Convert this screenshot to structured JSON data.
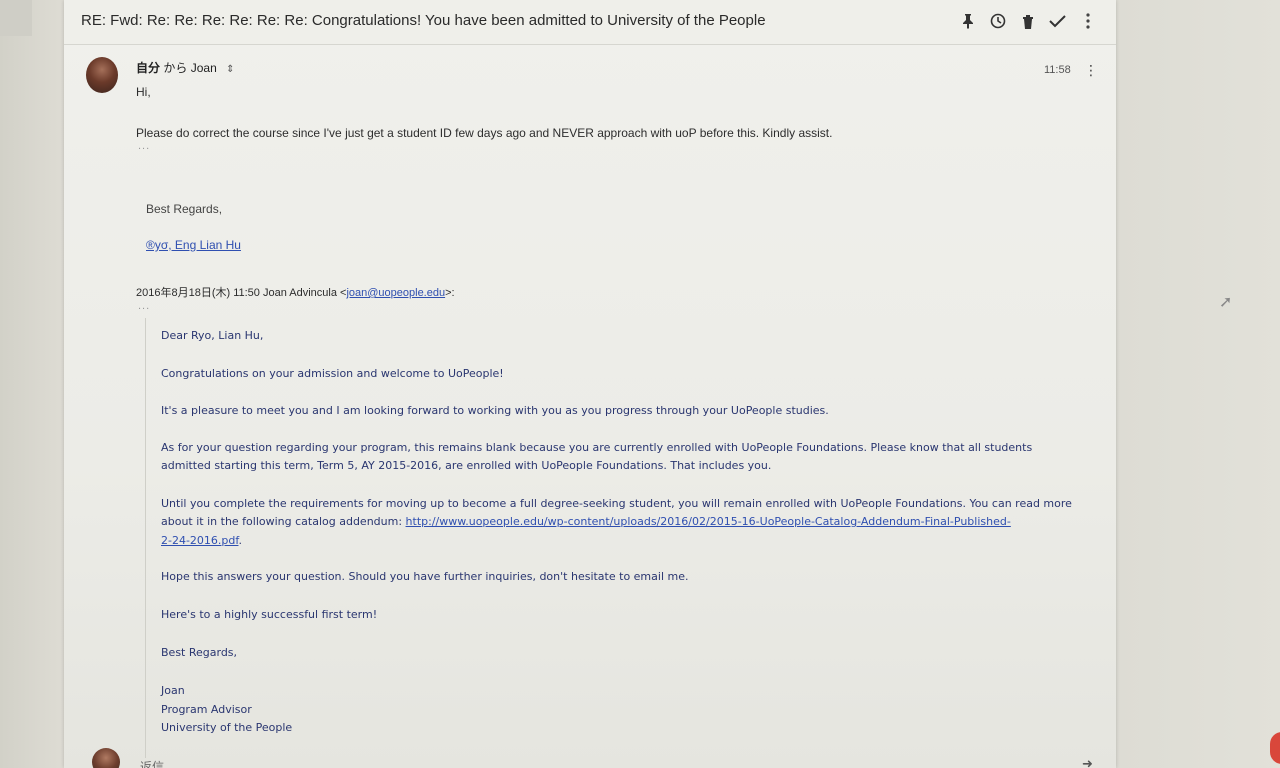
{
  "subject": "RE: Fwd: Re: Re: Re: Re: Re: Re: Congratulations! You have been admitted to University of the People",
  "toolbar": {
    "icons": [
      "pin-icon",
      "snooze-clock-icon",
      "trash-icon",
      "done-check-icon",
      "more-vert-icon"
    ]
  },
  "message": {
    "sender_me": "自分",
    "sender_middle": "から",
    "recipient": "Joan",
    "time": "11:58",
    "greeting": "Hi,",
    "body": "Please do correct the course since I've just get a student ID few days ago and NEVER approach with uoP before this. Kindly assist.",
    "ellipsis": "...",
    "sign_off": "Best Regards,",
    "signature_link": "®yσ, Eng Lian Hu"
  },
  "quoted_header": {
    "prefix": "2016年8月18日(木) 11:50 Joan Advincula <",
    "email": "joan@uopeople.edu",
    "suffix": ">:"
  },
  "quoted": {
    "l1": "Dear Ryo, Lian Hu,",
    "l2": "Congratulations on your admission and welcome to UoPeople!",
    "l3": "It's a pleasure to meet you and I am looking forward to working with you as you progress through your UoPeople studies.",
    "l4": "As for your question regarding your program, this remains blank because you are currently enrolled with UoPeople Foundations. Please know that all students",
    "l5": "admitted starting this term, Term 5, AY 2015-2016, are enrolled with UoPeople Foundations. That includes you.",
    "l6": "Until you complete the requirements for moving up to become a full degree-seeking student, you will remain enrolled with UoPeople Foundations. You can read more",
    "l7_prefix": "about it in the following catalog addendum: ",
    "l7_link": "http://www.uopeople.edu/wp-content/uploads/2016/02/2015-16-UoPeople-Catalog-Addendum-Final-Published-",
    "l8_link": "2-24-2016.pdf",
    "l8_suffix": ".",
    "l9": "Hope this answers your question. Should you have further inquiries, don't hesitate to email me.",
    "l10": "Here's to a highly successful first term!",
    "l11": "Best Regards,",
    "l12": "Joan",
    "l13": "Program Advisor",
    "l14": "University of the People"
  },
  "reply": {
    "label": "返信"
  }
}
